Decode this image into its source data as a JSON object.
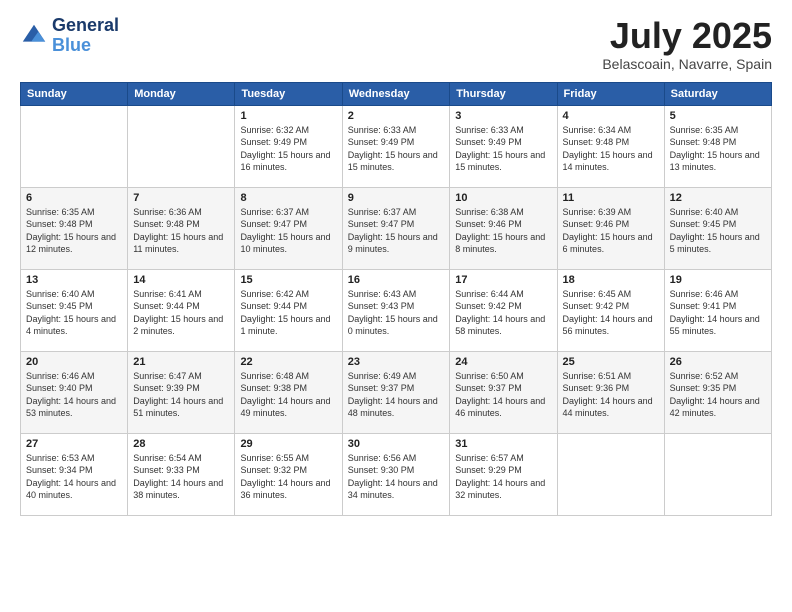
{
  "logo": {
    "line1": "General",
    "line2": "Blue"
  },
  "title": "July 2025",
  "location": "Belascoain, Navarre, Spain",
  "days_of_week": [
    "Sunday",
    "Monday",
    "Tuesday",
    "Wednesday",
    "Thursday",
    "Friday",
    "Saturday"
  ],
  "weeks": [
    [
      {
        "day": "",
        "info": ""
      },
      {
        "day": "",
        "info": ""
      },
      {
        "day": "1",
        "info": "Sunrise: 6:32 AM\nSunset: 9:49 PM\nDaylight: 15 hours and 16 minutes."
      },
      {
        "day": "2",
        "info": "Sunrise: 6:33 AM\nSunset: 9:49 PM\nDaylight: 15 hours and 15 minutes."
      },
      {
        "day": "3",
        "info": "Sunrise: 6:33 AM\nSunset: 9:49 PM\nDaylight: 15 hours and 15 minutes."
      },
      {
        "day": "4",
        "info": "Sunrise: 6:34 AM\nSunset: 9:48 PM\nDaylight: 15 hours and 14 minutes."
      },
      {
        "day": "5",
        "info": "Sunrise: 6:35 AM\nSunset: 9:48 PM\nDaylight: 15 hours and 13 minutes."
      }
    ],
    [
      {
        "day": "6",
        "info": "Sunrise: 6:35 AM\nSunset: 9:48 PM\nDaylight: 15 hours and 12 minutes."
      },
      {
        "day": "7",
        "info": "Sunrise: 6:36 AM\nSunset: 9:48 PM\nDaylight: 15 hours and 11 minutes."
      },
      {
        "day": "8",
        "info": "Sunrise: 6:37 AM\nSunset: 9:47 PM\nDaylight: 15 hours and 10 minutes."
      },
      {
        "day": "9",
        "info": "Sunrise: 6:37 AM\nSunset: 9:47 PM\nDaylight: 15 hours and 9 minutes."
      },
      {
        "day": "10",
        "info": "Sunrise: 6:38 AM\nSunset: 9:46 PM\nDaylight: 15 hours and 8 minutes."
      },
      {
        "day": "11",
        "info": "Sunrise: 6:39 AM\nSunset: 9:46 PM\nDaylight: 15 hours and 6 minutes."
      },
      {
        "day": "12",
        "info": "Sunrise: 6:40 AM\nSunset: 9:45 PM\nDaylight: 15 hours and 5 minutes."
      }
    ],
    [
      {
        "day": "13",
        "info": "Sunrise: 6:40 AM\nSunset: 9:45 PM\nDaylight: 15 hours and 4 minutes."
      },
      {
        "day": "14",
        "info": "Sunrise: 6:41 AM\nSunset: 9:44 PM\nDaylight: 15 hours and 2 minutes."
      },
      {
        "day": "15",
        "info": "Sunrise: 6:42 AM\nSunset: 9:44 PM\nDaylight: 15 hours and 1 minute."
      },
      {
        "day": "16",
        "info": "Sunrise: 6:43 AM\nSunset: 9:43 PM\nDaylight: 15 hours and 0 minutes."
      },
      {
        "day": "17",
        "info": "Sunrise: 6:44 AM\nSunset: 9:42 PM\nDaylight: 14 hours and 58 minutes."
      },
      {
        "day": "18",
        "info": "Sunrise: 6:45 AM\nSunset: 9:42 PM\nDaylight: 14 hours and 56 minutes."
      },
      {
        "day": "19",
        "info": "Sunrise: 6:46 AM\nSunset: 9:41 PM\nDaylight: 14 hours and 55 minutes."
      }
    ],
    [
      {
        "day": "20",
        "info": "Sunrise: 6:46 AM\nSunset: 9:40 PM\nDaylight: 14 hours and 53 minutes."
      },
      {
        "day": "21",
        "info": "Sunrise: 6:47 AM\nSunset: 9:39 PM\nDaylight: 14 hours and 51 minutes."
      },
      {
        "day": "22",
        "info": "Sunrise: 6:48 AM\nSunset: 9:38 PM\nDaylight: 14 hours and 49 minutes."
      },
      {
        "day": "23",
        "info": "Sunrise: 6:49 AM\nSunset: 9:37 PM\nDaylight: 14 hours and 48 minutes."
      },
      {
        "day": "24",
        "info": "Sunrise: 6:50 AM\nSunset: 9:37 PM\nDaylight: 14 hours and 46 minutes."
      },
      {
        "day": "25",
        "info": "Sunrise: 6:51 AM\nSunset: 9:36 PM\nDaylight: 14 hours and 44 minutes."
      },
      {
        "day": "26",
        "info": "Sunrise: 6:52 AM\nSunset: 9:35 PM\nDaylight: 14 hours and 42 minutes."
      }
    ],
    [
      {
        "day": "27",
        "info": "Sunrise: 6:53 AM\nSunset: 9:34 PM\nDaylight: 14 hours and 40 minutes."
      },
      {
        "day": "28",
        "info": "Sunrise: 6:54 AM\nSunset: 9:33 PM\nDaylight: 14 hours and 38 minutes."
      },
      {
        "day": "29",
        "info": "Sunrise: 6:55 AM\nSunset: 9:32 PM\nDaylight: 14 hours and 36 minutes."
      },
      {
        "day": "30",
        "info": "Sunrise: 6:56 AM\nSunset: 9:30 PM\nDaylight: 14 hours and 34 minutes."
      },
      {
        "day": "31",
        "info": "Sunrise: 6:57 AM\nSunset: 9:29 PM\nDaylight: 14 hours and 32 minutes."
      },
      {
        "day": "",
        "info": ""
      },
      {
        "day": "",
        "info": ""
      }
    ]
  ]
}
